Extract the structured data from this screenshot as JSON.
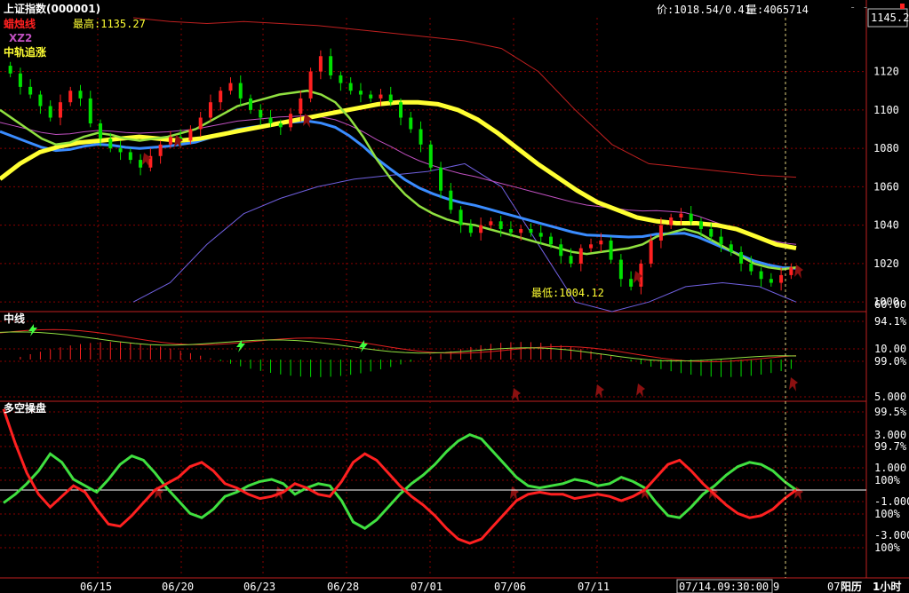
{
  "header": {
    "title": "上证指数(000001)",
    "price_label": "价:1018.54/0.41",
    "volume_label": "量:4065714",
    "corner_value": "1145.2"
  },
  "legend": {
    "line1": "蜡烛线",
    "line2": "XZ2",
    "line3": "中轨追涨",
    "high_label": "最高:1135.27",
    "low_label": "最低:1004.12"
  },
  "colors": {
    "up": "#ff2020",
    "down": "#00e000",
    "grid": "#8a0000",
    "axis": "#ff3030",
    "thin_green": "#90e040",
    "yellow": "#ffff33",
    "blue": "#3a8cff",
    "magenta": "#c050c0",
    "red_band": "#c02020",
    "purple_band": "#7060e0"
  },
  "chart_data": [
    {
      "type": "candlestick",
      "title": "上证指数(000001)",
      "ylim": [
        995,
        1148
      ],
      "yticks": [
        1000,
        1020,
        1040,
        1060,
        1080,
        1100,
        1120
      ],
      "high_marker": 1135.27,
      "low_marker": 1004.12,
      "series": [
        {
          "name": "蜡烛线",
          "close": [
            1119,
            1112,
            1108,
            1102,
            1096,
            1104,
            1110,
            1106,
            1093,
            1085,
            1080,
            1078,
            1074,
            1070,
            1076,
            1082,
            1086,
            1084,
            1090,
            1096,
            1104,
            1110,
            1114,
            1106,
            1100,
            1096,
            1093,
            1091,
            1098,
            1106,
            1120,
            1128,
            1118,
            1114,
            1110,
            1108,
            1106,
            1108,
            1104,
            1096,
            1090,
            1082,
            1070,
            1058,
            1048,
            1040,
            1036,
            1040,
            1042,
            1038,
            1036,
            1038,
            1036,
            1034,
            1030,
            1024,
            1020,
            1028,
            1030,
            1032,
            1022,
            1012,
            1008,
            1020,
            1032,
            1040,
            1044,
            1046,
            1042,
            1038,
            1034,
            1030,
            1026,
            1020,
            1016,
            1012,
            1010,
            1014,
            1018
          ]
        },
        {
          "name": "XZ2",
          "values": [
            1100,
            1095,
            1090,
            1085,
            1082,
            1083,
            1086,
            1088,
            1087,
            1085,
            1084,
            1085,
            1086,
            1088,
            1090,
            1094,
            1098,
            1102,
            1104,
            1106,
            1108,
            1109,
            1110,
            1108,
            1104,
            1096,
            1086,
            1074,
            1064,
            1056,
            1050,
            1046,
            1043,
            1041,
            1040,
            1038,
            1036,
            1034,
            1032,
            1030,
            1028,
            1026,
            1025,
            1026,
            1027,
            1028,
            1030,
            1034,
            1036,
            1038,
            1036,
            1032,
            1028,
            1024,
            1020,
            1018,
            1017,
            1018
          ]
        },
        {
          "name": "中轨追涨",
          "values": [
            1064,
            1072,
            1078,
            1081,
            1083,
            1084,
            1085,
            1086,
            1085,
            1084,
            1085,
            1087,
            1089,
            1091,
            1093,
            1095,
            1097,
            1099,
            1101,
            1103,
            1104,
            1104,
            1103,
            1100,
            1095,
            1088,
            1080,
            1072,
            1065,
            1058,
            1052,
            1048,
            1044,
            1042,
            1041,
            1041,
            1040,
            1038,
            1034,
            1030,
            1028
          ]
        },
        {
          "name": "upper_band",
          "values": [
            1148,
            1146,
            1145,
            1146,
            1145,
            1144,
            1142,
            1140,
            1138,
            1136,
            1132,
            1120,
            1100,
            1082,
            1072,
            1070,
            1068,
            1066,
            1065
          ]
        },
        {
          "name": "lower_band",
          "values": [
            1000,
            1010,
            1030,
            1046,
            1054,
            1060,
            1064,
            1066,
            1068,
            1072,
            1060,
            1030,
            1000,
            995,
            1000,
            1008,
            1010,
            1008,
            1000
          ]
        }
      ]
    },
    {
      "type": "line",
      "title": "中线",
      "tick_labels": [
        "94.1%",
        "10.00",
        "99.0%",
        "5.000"
      ]
    },
    {
      "type": "line",
      "title": "多空操盘",
      "tick_labels": [
        "99.5%",
        "3.000",
        "99.7%",
        "1.000",
        "100%",
        "-1.000",
        "100%",
        "-3.000",
        "100%"
      ],
      "series": [
        {
          "name": "green",
          "values": [
            -0.6,
            -0.2,
            0.3,
            0.9,
            1.7,
            1.3,
            0.5,
            0.2,
            -0.1,
            0.5,
            1.2,
            1.6,
            1.4,
            0.8,
            0.1,
            -0.5,
            -1.1,
            -1.3,
            -0.9,
            -0.3,
            -0.1,
            0.2,
            0.4,
            0.5,
            0.3,
            -0.2,
            0.1,
            0.3,
            0.2,
            -0.5,
            -1.5,
            -1.8,
            -1.4,
            -0.8,
            -0.2,
            0.3,
            0.7,
            1.2,
            1.8,
            2.3,
            2.6,
            2.4,
            1.8,
            1.2,
            0.6,
            0.2,
            0.1,
            0.2,
            0.3,
            0.5,
            0.4,
            0.2,
            0.3,
            0.6,
            0.4,
            0.1,
            -0.6,
            -1.2,
            -1.3,
            -0.8,
            -0.2,
            0.2,
            0.7,
            1.1,
            1.3,
            1.2,
            0.9,
            0.4,
            0
          ]
        },
        {
          "name": "red",
          "values": [
            3.8,
            2.2,
            0.8,
            -0.2,
            -0.8,
            -0.3,
            0.2,
            -0.1,
            -0.9,
            -1.6,
            -1.7,
            -1.2,
            -0.6,
            0,
            0.3,
            0.6,
            1.1,
            1.3,
            0.9,
            0.3,
            0.1,
            -0.2,
            -0.4,
            -0.3,
            -0.1,
            0.3,
            0.1,
            -0.2,
            -0.3,
            0.4,
            1.3,
            1.7,
            1.4,
            0.8,
            0.2,
            -0.3,
            -0.7,
            -1.2,
            -1.8,
            -2.3,
            -2.5,
            -2.3,
            -1.7,
            -1.1,
            -0.5,
            -0.2,
            -0.1,
            -0.2,
            -0.2,
            -0.4,
            -0.3,
            -0.2,
            -0.3,
            -0.5,
            -0.3,
            0,
            0.6,
            1.2,
            1.4,
            0.9,
            0.3,
            -0.2,
            -0.7,
            -1.1,
            -1.3,
            -1.2,
            -0.9,
            -0.4,
            0
          ]
        }
      ]
    }
  ],
  "x_axis": {
    "labels": [
      "06/15",
      "06/20",
      "06/23",
      "06/28",
      "07/01",
      "07/06",
      "07/11",
      "07/14.09:30:00",
      "9",
      "07",
      "阳历",
      "1小时"
    ]
  }
}
